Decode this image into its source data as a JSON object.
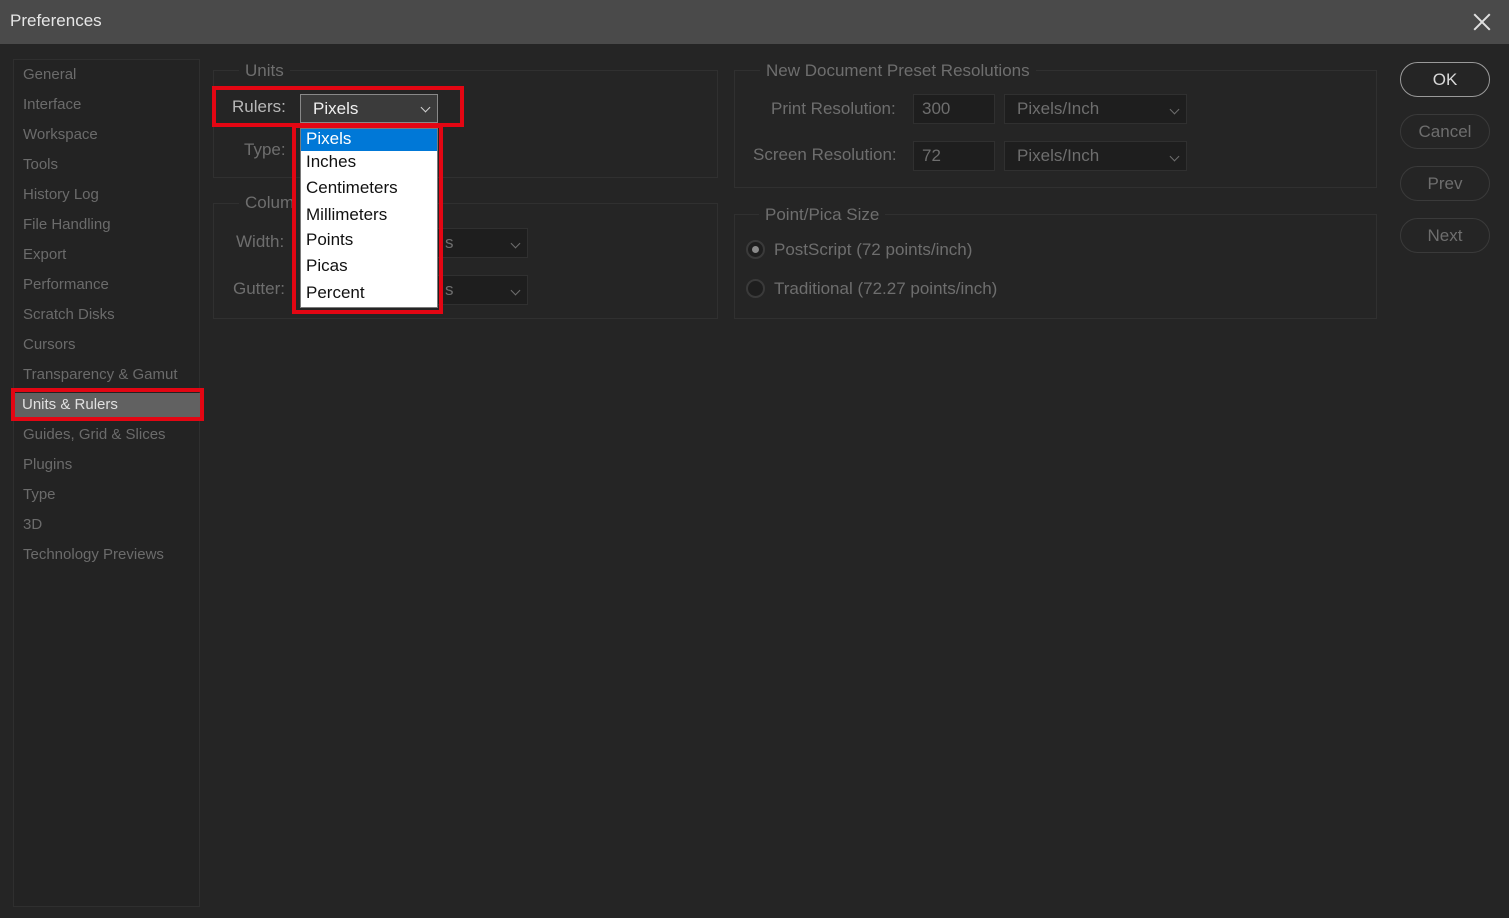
{
  "window": {
    "title": "Preferences"
  },
  "sidebar": {
    "items": [
      "General",
      "Interface",
      "Workspace",
      "Tools",
      "History Log",
      "File Handling",
      "Export",
      "Performance",
      "Scratch Disks",
      "Cursors",
      "Transparency & Gamut",
      "Units & Rulers",
      "Guides, Grid & Slices",
      "Plugins",
      "Type",
      "3D",
      "Technology Previews"
    ],
    "active": "Units & Rulers"
  },
  "units": {
    "legend": "Units",
    "rulers_label": "Rulers:",
    "rulers_value": "Pixels",
    "type_label": "Type:",
    "options": [
      "Pixels",
      "Inches",
      "Centimeters",
      "Millimeters",
      "Points",
      "Picas",
      "Percent"
    ],
    "selected_option": "Pixels"
  },
  "columns": {
    "legend": "Colum",
    "width_label": "Width:",
    "width_unit_tail": "s",
    "gutter_label": "Gutter:",
    "gutter_unit_tail": "s"
  },
  "resolutions": {
    "legend": "New Document Preset Resolutions",
    "print_label": "Print Resolution:",
    "print_value": "300",
    "print_unit": "Pixels/Inch",
    "screen_label": "Screen Resolution:",
    "screen_value": "72",
    "screen_unit": "Pixels/Inch"
  },
  "pica": {
    "legend": "Point/Pica Size",
    "postscript": "PostScript (72 points/inch)",
    "traditional": "Traditional (72.27 points/inch)"
  },
  "buttons": {
    "ok": "OK",
    "cancel": "Cancel",
    "prev": "Prev",
    "next": "Next"
  }
}
